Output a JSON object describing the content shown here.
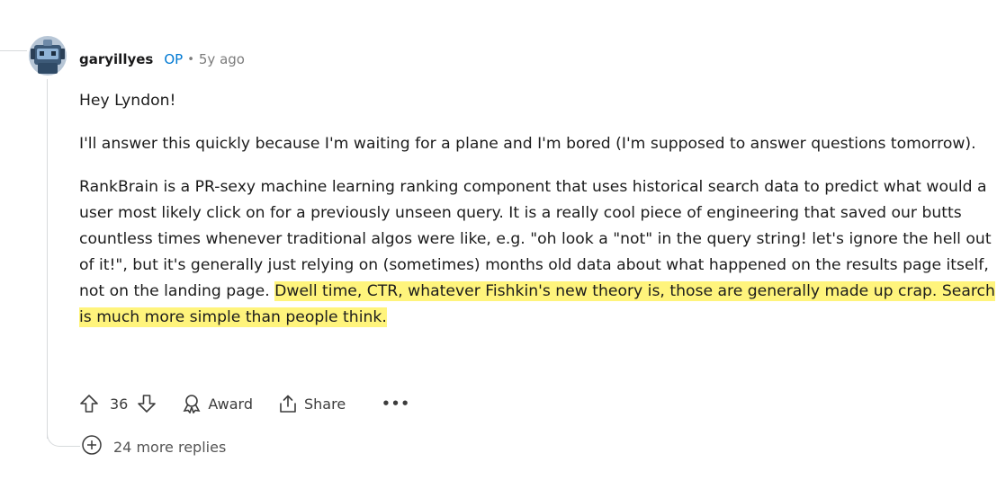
{
  "comment": {
    "username": "garyillyes",
    "op_badge": "OP",
    "separator": "•",
    "time_ago": "5y ago",
    "paragraphs": [
      "Hey Lyndon!",
      "I'll answer this quickly because I'm waiting for a plane and I'm bored (I'm supposed to answer questions tomorrow).",
      "RankBrain is a PR-sexy machine learning ranking component that uses historical search data to predict what would a user most likely click on for a previously unseen query. It is a really cool piece of engineering that saved our butts countless times whenever traditional algos were like, e.g. \"oh look a \"not\" in the query string! let's ignore the hell out of it!\", but it's generally just relying on (sometimes) months old data about what happened on the results page itself, not on the landing page."
    ],
    "highlighted_text": "Dwell time, CTR, whatever Fishkin's new theory is, those are generally made up crap. Search is much more simple than people think.",
    "highlight_color": "#fff47c"
  },
  "actions": {
    "vote_count": "36",
    "award_label": "Award",
    "share_label": "Share",
    "more_label": "•••"
  },
  "replies": {
    "more_replies_label": "24 more replies"
  },
  "icons": {
    "upvote": "arrow-up-icon",
    "downvote": "arrow-down-icon",
    "award": "award-icon",
    "share": "share-icon",
    "more": "ellipsis-icon",
    "expand": "plus-circle-icon"
  },
  "colors": {
    "op": "#0079d3",
    "meta": "#7c7c7c",
    "thread_line": "#d7dadc"
  }
}
